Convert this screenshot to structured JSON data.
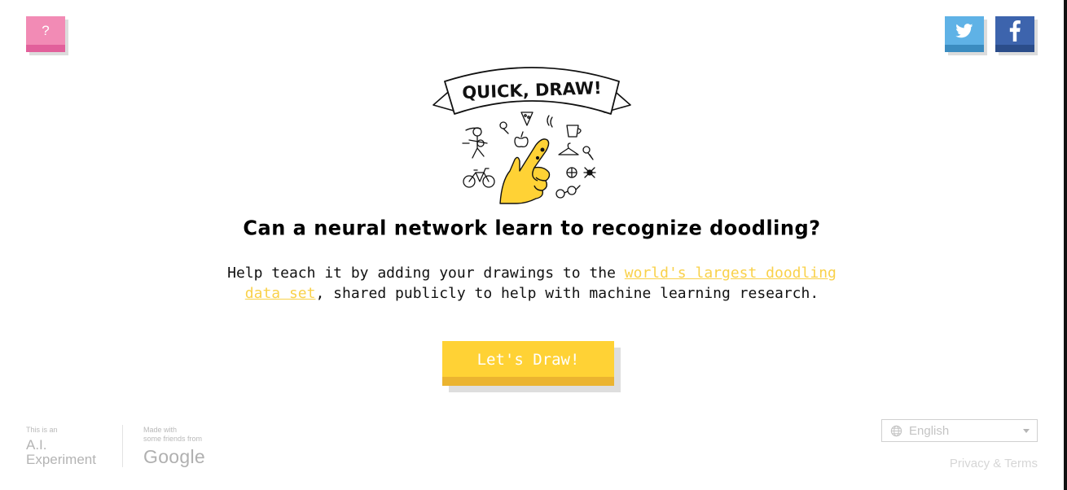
{
  "header": {
    "help_label": "?",
    "twitter_icon": "twitter-bird-icon",
    "facebook_icon": "facebook-f-icon"
  },
  "logo": {
    "text": "QUICK, DRAW!"
  },
  "main": {
    "headline": "Can a neural network learn to recognize doodling?",
    "desc_before": "Help teach it by adding your drawings to the ",
    "desc_link": "world's largest doodling data set",
    "desc_after": ", shared publicly to help with machine learning research.",
    "cta_label": "Let's Draw!"
  },
  "footer": {
    "ai_small": "This is an",
    "ai_line1": "A.I.",
    "ai_line2": "Experiment",
    "made_with_1": "Made with",
    "made_with_2": "some friends from",
    "google_label": "Google",
    "language": "English",
    "privacy": "Privacy & Terms"
  },
  "colors": {
    "accent_yellow": "#ffd235",
    "link_yellow": "#f9d14a",
    "help_pink": "#f28bb5",
    "twitter_blue": "#5fb2e6",
    "facebook_blue": "#3d64ad"
  }
}
